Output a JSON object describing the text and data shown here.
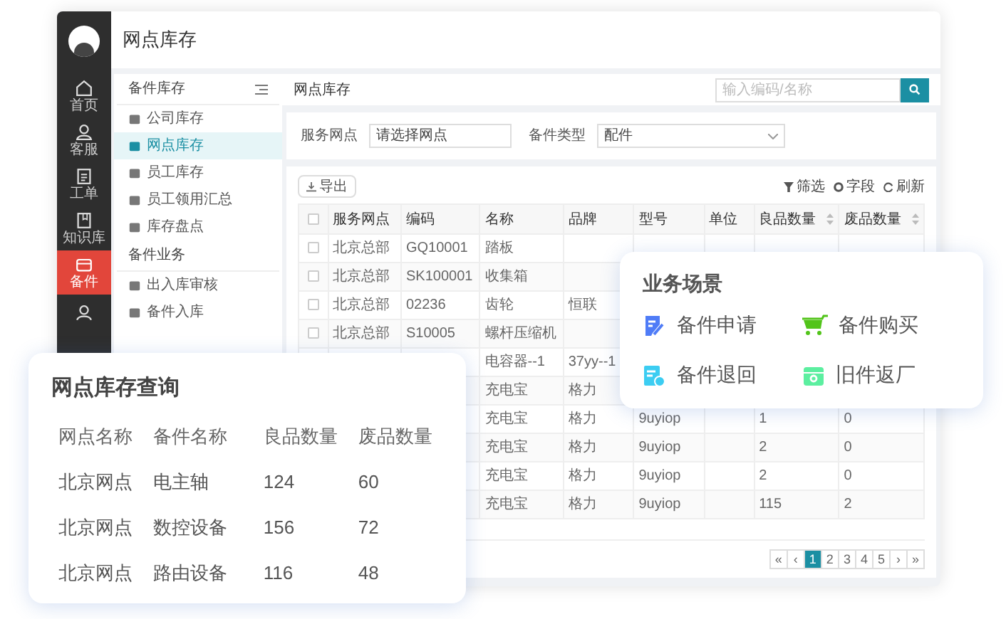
{
  "app": {
    "title": "网点库存"
  },
  "rail": [
    {
      "label": "首页",
      "selected": false
    },
    {
      "label": "客服",
      "selected": false
    },
    {
      "label": "工单",
      "selected": false
    },
    {
      "label": "知识库",
      "selected": false
    },
    {
      "label": "备件",
      "selected": true
    }
  ],
  "sidebar": {
    "sections": [
      {
        "title": "备件库存",
        "items": [
          {
            "label": "公司库存",
            "selected": false
          },
          {
            "label": "网点库存",
            "selected": true
          },
          {
            "label": "员工库存",
            "selected": false
          },
          {
            "label": "员工领用汇总",
            "selected": false
          },
          {
            "label": "库存盘点",
            "selected": false
          }
        ]
      },
      {
        "title": "备件业务",
        "items": [
          {
            "label": "出入库审核",
            "selected": false
          },
          {
            "label": "备件入库",
            "selected": false
          }
        ]
      }
    ]
  },
  "page": {
    "title": "网点库存",
    "search": {
      "placeholder": "输入编码/名称"
    }
  },
  "filters": [
    {
      "kind": "input",
      "label": "服务网点",
      "placeholder": "请选择网点"
    },
    {
      "kind": "select",
      "label": "备件类型",
      "value": "配件"
    }
  ],
  "toolbar": {
    "export": "导出",
    "actions": [
      "筛选",
      "字段",
      "刷新"
    ]
  },
  "table": {
    "columns": [
      {
        "label": "服务网点",
        "sortable": false
      },
      {
        "label": "编码",
        "sortable": false
      },
      {
        "label": "名称",
        "sortable": false
      },
      {
        "label": "品牌",
        "sortable": false
      },
      {
        "label": "型号",
        "sortable": false
      },
      {
        "label": "单位",
        "sortable": false
      },
      {
        "label": "良品数量",
        "sortable": true
      },
      {
        "label": "废品数量",
        "sortable": true
      }
    ],
    "rows": [
      {
        "checked": false,
        "site": "北京总部",
        "code": "GQ10001",
        "name": "踏板"
      },
      {
        "checked": false,
        "site": "北京总部",
        "code": "SK100001",
        "name": "收集箱"
      },
      {
        "checked": false,
        "site": "北京总部",
        "code": "02236",
        "name": "齿轮",
        "brand": "恒联"
      },
      {
        "checked": false,
        "site": "北京总部",
        "code": "S10005",
        "name": "螺杆压缩机"
      },
      {
        "name": "电容器--1",
        "brand": "37yy--1"
      },
      {
        "name": "充电宝",
        "brand": "格力"
      },
      {
        "name": "充电宝",
        "brand": "格力",
        "model": "9uyiop",
        "good": "1",
        "scrap": "0"
      },
      {
        "name": "充电宝",
        "brand": "格力",
        "model": "9uyiop",
        "good": "2",
        "scrap": "0"
      },
      {
        "name": "充电宝",
        "brand": "格力",
        "model": "9uyiop",
        "good": "2",
        "scrap": "0"
      },
      {
        "name": "充电宝",
        "brand": "格力",
        "model": "9uyiop",
        "good": "115",
        "scrap": "2"
      }
    ],
    "all_checked": false
  },
  "pagination": [
    {
      "label": "«",
      "selected": false
    },
    {
      "label": "‹",
      "selected": false
    },
    {
      "label": "1",
      "selected": true
    },
    {
      "label": "2",
      "selected": false
    },
    {
      "label": "3",
      "selected": false
    },
    {
      "label": "4",
      "selected": false
    },
    {
      "label": "5",
      "selected": false
    },
    {
      "label": "›",
      "selected": false
    },
    {
      "label": "»",
      "selected": false
    }
  ],
  "query_card": {
    "title": "网点库存查询",
    "columns": [
      "网点名称",
      "备件名称",
      "良品数量",
      "废品数量"
    ],
    "rows": [
      [
        "北京网点",
        "电主轴",
        "124",
        "60"
      ],
      [
        "北京网点",
        "数控设备",
        "156",
        "72"
      ],
      [
        "北京网点",
        "路由设备",
        "116",
        "48"
      ]
    ]
  },
  "scenario_card": {
    "title": "业务场景",
    "items": [
      {
        "label": "备件申请",
        "color": "#4f7cf7"
      },
      {
        "label": "备件购买",
        "color": "#52c41a"
      },
      {
        "label": "备件退回",
        "color": "#3ccdf2"
      },
      {
        "label": "旧件返厂",
        "color": "#5cefa0"
      }
    ]
  }
}
